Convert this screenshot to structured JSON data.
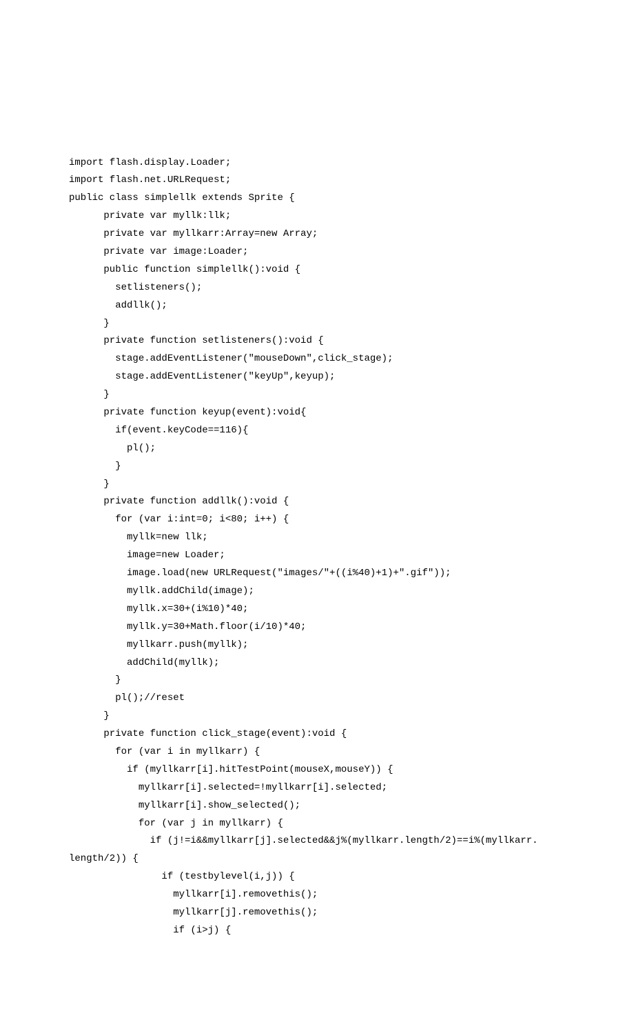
{
  "code": {
    "lines": [
      "import flash.display.Loader;",
      "import flash.net.URLRequest;",
      "public class simplellk extends Sprite {",
      "      private var myllk:llk;",
      "      private var myllkarr:Array=new Array;",
      "      private var image:Loader;",
      "      public function simplellk():void {",
      "        setlisteners();",
      "        addllk();",
      "      }",
      "      private function setlisteners():void {",
      "        stage.addEventListener(\"mouseDown\",click_stage);",
      "        stage.addEventListener(\"keyUp\",keyup);",
      "      }",
      "      private function keyup(event):void{",
      "        if(event.keyCode==116){",
      "          pl();",
      "        }",
      "      }",
      "      private function addllk():void {",
      "        for (var i:int=0; i<80; i++) {",
      "          myllk=new llk;",
      "          image=new Loader;",
      "          image.load(new URLRequest(\"images/\"+((i%40)+1)+\".gif\"));",
      "          myllk.addChild(image);",
      "          myllk.x=30+(i%10)*40;",
      "          myllk.y=30+Math.floor(i/10)*40;",
      "          myllkarr.push(myllk);",
      "          addChild(myllk);",
      "        }",
      "        pl();//reset",
      "      }",
      "      private function click_stage(event):void {",
      "        for (var i in myllkarr) {",
      "          if (myllkarr[i].hitTestPoint(mouseX,mouseY)) {",
      "            myllkarr[i].selected=!myllkarr[i].selected;",
      "            myllkarr[i].show_selected();",
      "            for (var j in myllkarr) {",
      "              if (j!=i&&myllkarr[j].selected&&j%(myllkarr.length/2)==i%(myllkarr.",
      "length/2)) {",
      "                if (testbylevel(i,j)) {",
      "                  myllkarr[i].removethis();",
      "                  myllkarr[j].removethis();",
      "                  if (i>j) {"
    ]
  }
}
